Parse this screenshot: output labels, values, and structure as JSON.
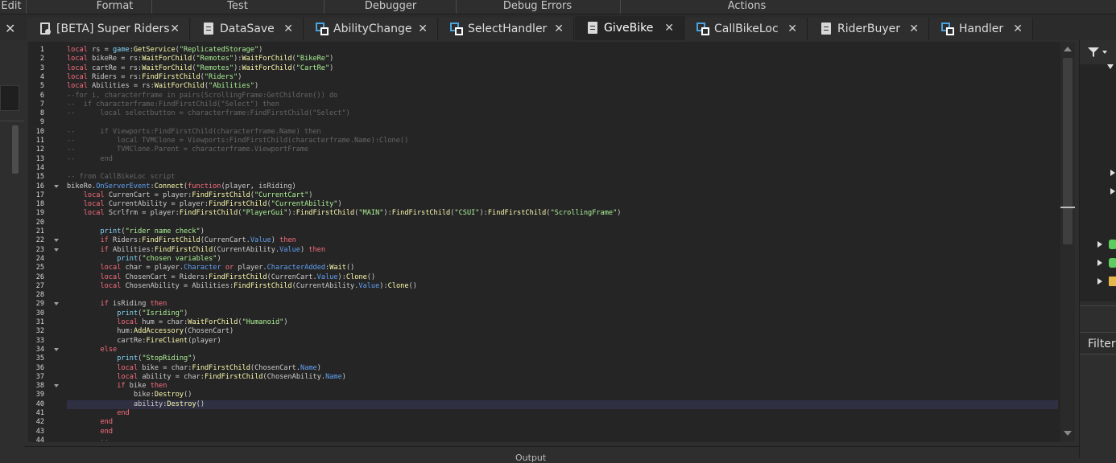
{
  "ribbon": {
    "groups": [
      "Edit",
      "Format",
      "Test",
      "Debugger",
      "Debug Errors",
      "Actions"
    ]
  },
  "tabs": [
    {
      "label": "[BETA] Super Riders",
      "icon": "local-script-icon"
    },
    {
      "label": "DataSave",
      "icon": "script-icon"
    },
    {
      "label": "AbilityChange",
      "icon": "module-script-icon"
    },
    {
      "label": "SelectHandler",
      "icon": "module-script-icon"
    },
    {
      "label": "GiveBike",
      "icon": "script-icon",
      "active": true
    },
    {
      "label": "CallBikeLoc",
      "icon": "module-script-icon"
    },
    {
      "label": "RiderBuyer",
      "icon": "script-icon"
    },
    {
      "label": "Handler",
      "icon": "module-script-icon"
    }
  ],
  "close_glyph": "✕",
  "editor": {
    "line_numbers": [
      "1",
      "2",
      "3",
      "4",
      "5",
      "6",
      "7",
      "8",
      "9",
      "10",
      "11",
      "12",
      "13",
      "14",
      "15",
      "16",
      "17",
      "18",
      "19",
      "20",
      "21",
      "22",
      "23",
      "24",
      "25",
      "26",
      "27",
      "28",
      "29",
      "30",
      "31",
      "32",
      "33",
      "34",
      "35",
      "36",
      "37",
      "38",
      "39",
      "40",
      "41",
      "42",
      "43",
      "44"
    ],
    "fold_lines": [
      16,
      22,
      23,
      29,
      34,
      38
    ],
    "current_line": 40,
    "lines": [
      "local rs = game:GetService(\"ReplicatedStorage\")",
      "local bikeRe = rs:WaitForChild(\"Remotes\"):WaitForChild(\"BikeRe\")",
      "local cartRe = rs:WaitForChild(\"Remotes\"):WaitForChild(\"CartRe\")",
      "local Riders = rs:FindFirstChild(\"Riders\")",
      "local Abilities = rs:WaitForChild(\"Abilities\")",
      "--for i, characterframe in pairs(ScrollingFrame:GetChildren()) do",
      "--  if characterframe:FindFirstChild(\"Select\") then",
      "--      local selectbutton = characterframe:FindFirstChild(\"Select\")",
      "",
      "--      if Viewports:FindFirstChild(characterframe.Name) then",
      "--          local TVMClone = Viewports:FindFirstChild(characterframe.Name):Clone()",
      "--          TVMClone.Parent = characterframe.ViewportFrame",
      "--      end",
      "",
      "-- from CallBikeLoc script",
      "bikeRe.OnServerEvent:Connect(function(player, isRiding)",
      "    local CurrenCart = player:FindFirstChild(\"CurrentCart\")",
      "    local CurrentAbility = player:FindFirstChild(\"CurrentAbility\")",
      "    local Scrlfrm = player:FindFirstChild(\"PlayerGui\"):FindFirstChild(\"MAIN\"):FindFirstChild(\"CSUI\"):FindFirstChild(\"ScrollingFrame\")",
      "",
      "        print(\"rider name check\")",
      "        if Riders:FindFirstChild(CurrenCart.Value) then",
      "        if Abilities:FindFirstChild(CurrentAbility.Value) then",
      "            print(\"chosen variables\")",
      "        local char = player.Character or player.CharacterAdded:Wait()",
      "        local ChosenCart = Riders:FindFirstChild(CurrenCart.Value):Clone()",
      "        local ChosenAbility = Abilities:FindFirstChild(CurrentAbility.Value):Clone()",
      "",
      "        if isRiding then",
      "            print(\"Isriding\")",
      "            local hum = char:WaitForChild(\"Humanoid\")",
      "            hum:AddAccessory(ChosenCart)",
      "            cartRe:FireClient(player)",
      "        else",
      "            print(\"StopRiding\")",
      "            local bike = char:FindFirstChild(ChosenCart.Name)",
      "            local ability = char:FindFirstChild(ChosenAbility.Name)",
      "            if bike then",
      "                bike:Destroy()",
      "                ability:Destroy()",
      "            end",
      "        end",
      "        end",
      "        --"
    ]
  },
  "rightpanel": {
    "filter_label": "Filter"
  },
  "output": {
    "title": "Output"
  },
  "colors": {
    "keyword": "#f86d7c",
    "builtin": "#84d6f7",
    "method": "#fdfbac",
    "string": "#adf195",
    "comment": "#666666",
    "text": "#cccccc",
    "property": "#61a1f1"
  }
}
